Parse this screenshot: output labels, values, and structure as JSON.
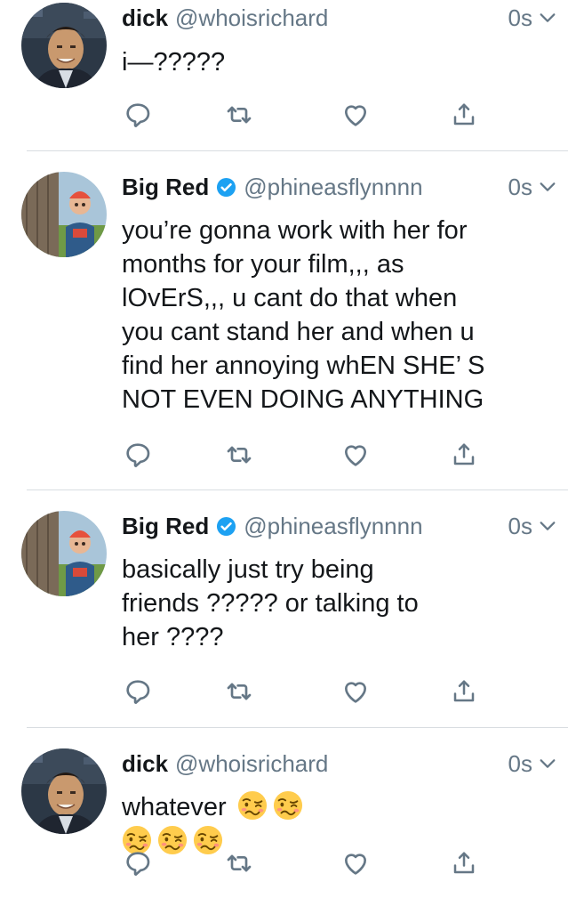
{
  "tweets": [
    {
      "name": "dick",
      "handle": "@whoisrichard",
      "verified": false,
      "time": "0s",
      "lines": [
        "i—?????"
      ]
    },
    {
      "name": "Big Red",
      "handle": "@phineasflynnnn",
      "verified": true,
      "time": "0s",
      "lines": [
        "you’re gonna work with her for",
        "months for your film,,, as",
        "lOvErS,,, u cant do that when",
        "you cant stand her and when u",
        "find her annoying whEN SHE’ S",
        "NOT EVEN DOING ANYTHING"
      ]
    },
    {
      "name": "Big Red",
      "handle": "@phineasflynnnn",
      "verified": true,
      "time": "0s",
      "lines": [
        "basically just try being",
        "friends ????? or talking  to",
        "her ????"
      ]
    },
    {
      "name": "dick",
      "handle": "@whoisrichard",
      "verified": false,
      "time": "0s",
      "lines": [
        "whatever"
      ],
      "emoji": "woozy-face-emoji"
    }
  ],
  "icons": {
    "reply": "reply-icon",
    "retweet": "retweet-icon",
    "like": "heart-icon",
    "share": "share-icon",
    "verified": "verified-badge-icon",
    "caret": "chevron-down-icon"
  },
  "colors": {
    "text": "#14171a",
    "secondary": "#657786",
    "verified": "#1da1f2",
    "divider": "#d9dde1"
  }
}
